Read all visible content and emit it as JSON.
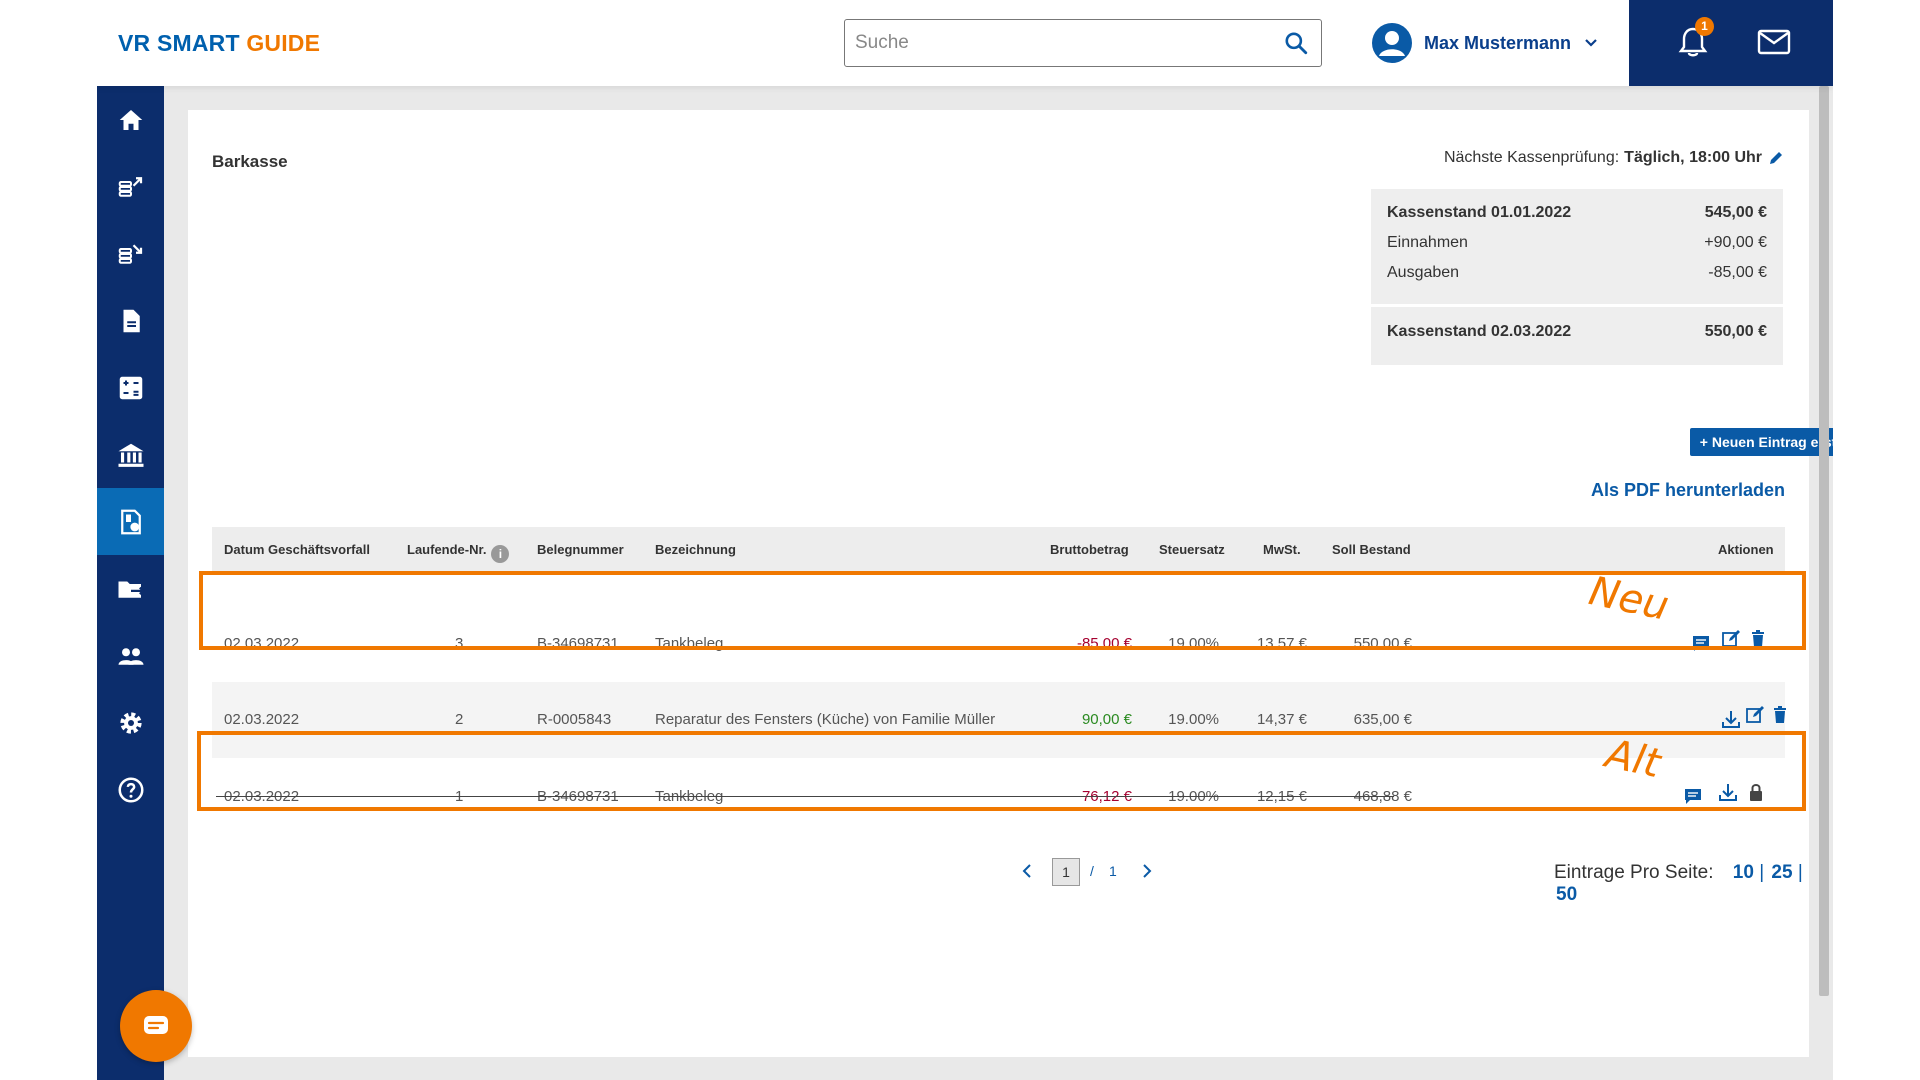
{
  "app": {
    "logo_part1": "VR SMART ",
    "logo_part2": "GUIDE",
    "brand_colors": {
      "blue": "#0c2d6c",
      "accent": "#f07800",
      "link": "#0a5aa6"
    }
  },
  "header": {
    "search_placeholder": "Suche",
    "user_name": "Max Mustermann",
    "notification_count": "1"
  },
  "sidebar": {
    "items": [
      {
        "icon": "home-icon"
      },
      {
        "icon": "money-out-icon"
      },
      {
        "icon": "money-in-icon"
      },
      {
        "icon": "document-icon"
      },
      {
        "icon": "calculator-icon"
      },
      {
        "icon": "bank-icon"
      },
      {
        "icon": "cashbook-icon",
        "active": true
      },
      {
        "icon": "folder-export-icon"
      },
      {
        "icon": "people-icon"
      },
      {
        "icon": "settings-icon"
      },
      {
        "icon": "help-icon"
      }
    ]
  },
  "page": {
    "title": "Barkasse",
    "next_check_label": "Nächste Kassenprüfung:",
    "next_check_value": "Täglich, 18:00 Uhr",
    "new_entry_button": "+ Neuen Eintrag erstellen",
    "pdf_link": "Als PDF herunterladen"
  },
  "summary": {
    "start_label": "Kassenstand 01.01.2022",
    "start_value": "545,00 €",
    "income_label": "Einnahmen",
    "income_value": "+90,00 €",
    "expenses_label": "Ausgaben",
    "expenses_value": "-85,00 €",
    "end_label": "Kassenstand 02.03.2022",
    "end_value": "550,00 €"
  },
  "table": {
    "headers": {
      "date": "Datum Geschäftsvorfall",
      "seq": "Laufende-Nr.",
      "receipt": "Belegnummer",
      "desc": "Bezeichnung",
      "gross": "Bruttobetrag",
      "rate": "Steuersatz",
      "vat": "MwSt.",
      "balance": "Soll Bestand",
      "actions": "Aktionen"
    },
    "rows": [
      {
        "date": "02.03.2022",
        "seq": "3",
        "receipt": "B-34698731",
        "desc": "Tankbeleg",
        "gross": "-85,00 €",
        "rate": "19.00%",
        "vat": "13,57 €",
        "balance": "550,00 €"
      },
      {
        "date": "02.03.2022",
        "seq": "2",
        "receipt": "R-0005843",
        "desc": "Reparatur des Fensters (Küche) von Familie Müller",
        "gross": "90,00 €",
        "rate": "19.00%",
        "vat": "14,37 €",
        "balance": "635,00 €"
      },
      {
        "date": "02.03.2022",
        "seq": "1",
        "receipt": "B-34698731",
        "desc": "Tankbeleg",
        "gross": "76,12 €",
        "rate": "19.00%",
        "vat": "12,15 €",
        "balance": "468,88 €"
      }
    ]
  },
  "annotations": {
    "new": "Neu",
    "old": "Alt"
  },
  "pagination": {
    "current": "1",
    "separator": "/",
    "total": "1",
    "per_page_label": "Eintrage Pro Seite:",
    "options": [
      "10",
      "25",
      "50"
    ]
  }
}
